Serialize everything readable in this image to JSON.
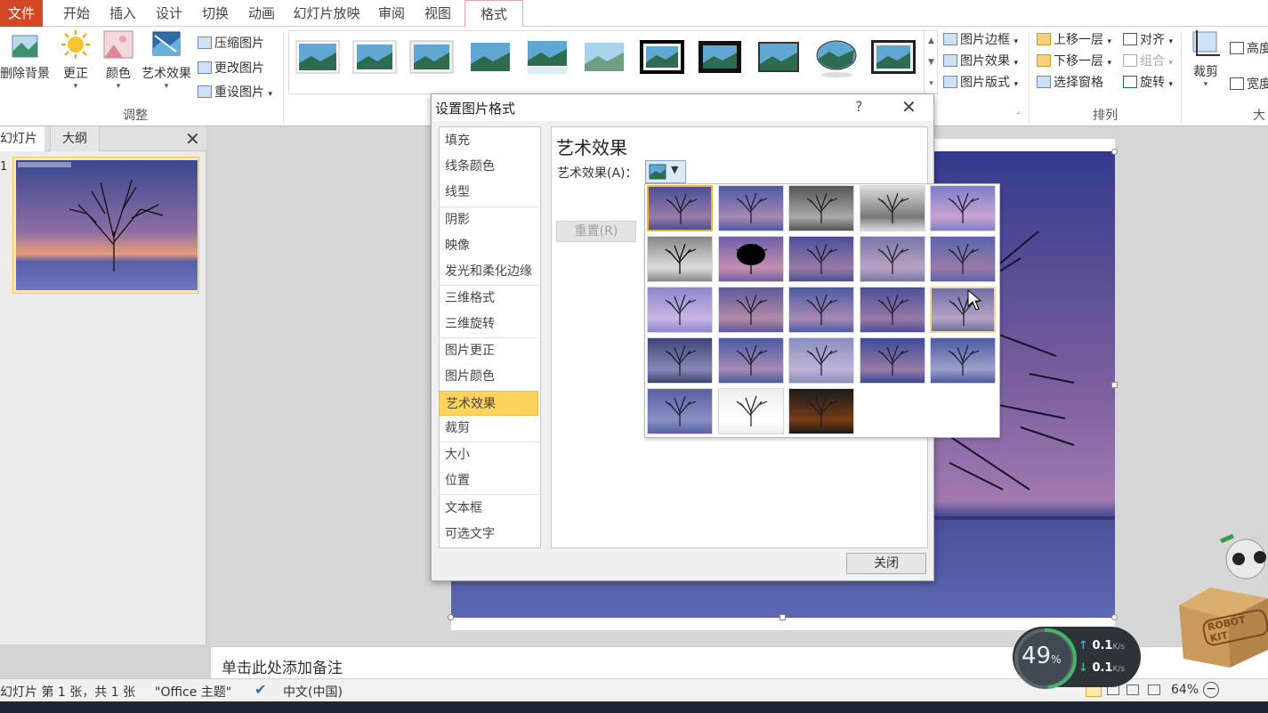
{
  "tabs": [
    "文件",
    "开始",
    "插入",
    "设计",
    "切换",
    "动画",
    "幻灯片放映",
    "审阅",
    "视图",
    "格式"
  ],
  "ribbon": {
    "adjust": {
      "remove_bg": "删除背景",
      "correct": "更正",
      "color": "颜色",
      "art": "艺术效果",
      "compress": "压缩图片",
      "change": "更改图片",
      "reset": "重设图片",
      "group_label": "调整"
    },
    "styles": {
      "border": "图片边框",
      "effects": "图片效果",
      "layout": "图片版式"
    },
    "arrange": {
      "forward": "上移一层",
      "backward": "下移一层",
      "pane": "选择窗格",
      "align": "对齐",
      "group": "组合",
      "rotate": "旋转",
      "group_label": "排列"
    },
    "size": {
      "crop": "裁剪",
      "height": "高度",
      "width": "宽度",
      "group_label": "大小"
    }
  },
  "slides_panel": {
    "tab_slides": "幻灯片",
    "tab_outline": "大纲",
    "slide_number": "1"
  },
  "dialog": {
    "title": "设置图片格式",
    "help": "?",
    "nav": [
      "填充",
      "线条颜色",
      "线型",
      "阴影",
      "映像",
      "发光和柔化边缘",
      "三维格式",
      "三维旋转",
      "图片更正",
      "图片颜色",
      "艺术效果",
      "裁剪",
      "大小",
      "位置",
      "文本框",
      "可选文字"
    ],
    "selected_nav": "艺术效果",
    "heading": "艺术效果",
    "effect_label": "艺术效果(A)：",
    "reset_button": "重置(R)",
    "close_button": "关闭"
  },
  "notes": "单击此处添加备注",
  "status": {
    "slide_info": "幻灯片 第 1 张，共 1 张",
    "theme": "\"Office 主题\"",
    "language": "中文(中国)",
    "zoom": "64%"
  },
  "network": {
    "percent": "49",
    "unit": "%",
    "up": "0.1",
    "down": "0.1",
    "rate_unit": "K/s"
  },
  "mascot": {
    "label": "ROBOT KIT"
  },
  "colors": {
    "file_tab": "#d24726",
    "selected_nav": "#fcd35c",
    "accent_pink": "#e7aabd"
  }
}
